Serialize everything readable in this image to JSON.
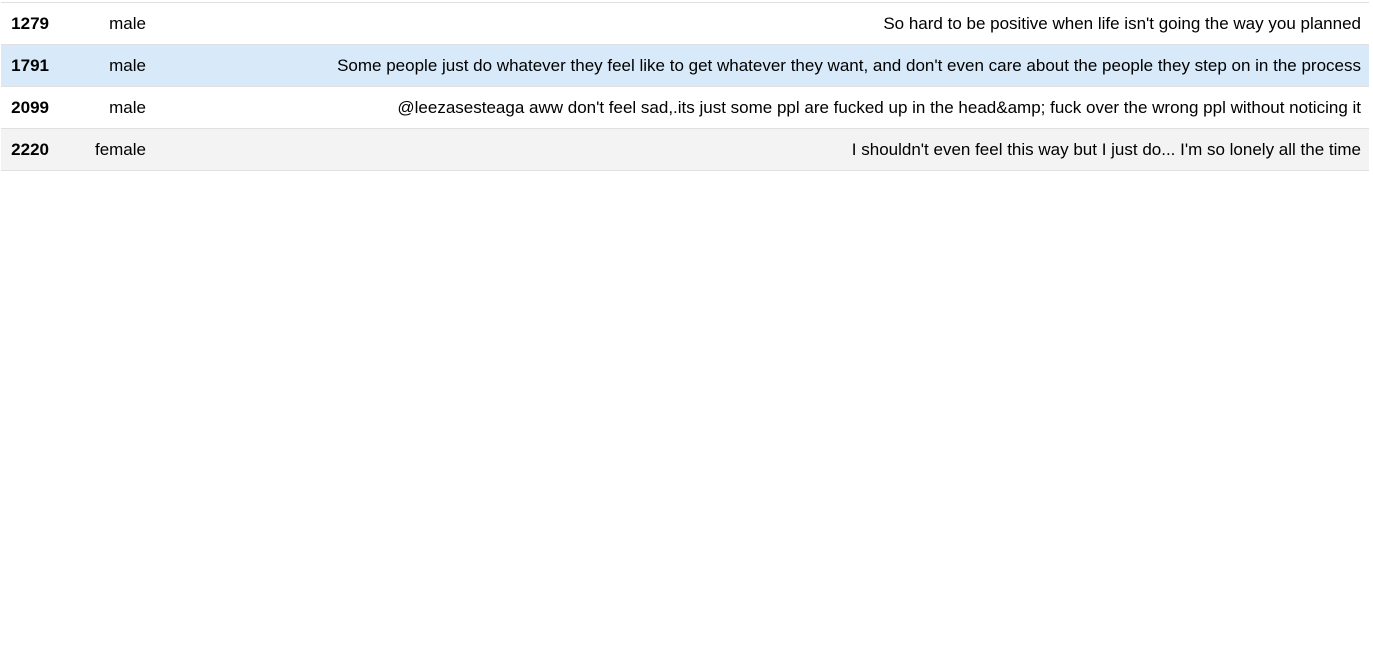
{
  "rows": [
    {
      "id": "1279",
      "gender": "male",
      "text": "So hard to be positive when life isn't going the way you planned",
      "style": "white"
    },
    {
      "id": "1791",
      "gender": "male",
      "text": "Some people just do whatever they feel like to get whatever they want, and don't even care about the people they step on in the process",
      "style": "selected"
    },
    {
      "id": "2099",
      "gender": "male",
      "text": "@leezasesteaga aww don't feel sad,.its just some ppl are fucked up in the head&amp; fuck over the wrong ppl without noticing it",
      "style": "white"
    },
    {
      "id": "2220",
      "gender": "female",
      "text": "I shouldn't even feel this way but I just do... I'm so lonely all the time",
      "style": "grey"
    }
  ],
  "colors": {
    "selected_row": "#d8eaf9",
    "alt_row": "#f3f3f3",
    "border": "#e0e0e0"
  }
}
